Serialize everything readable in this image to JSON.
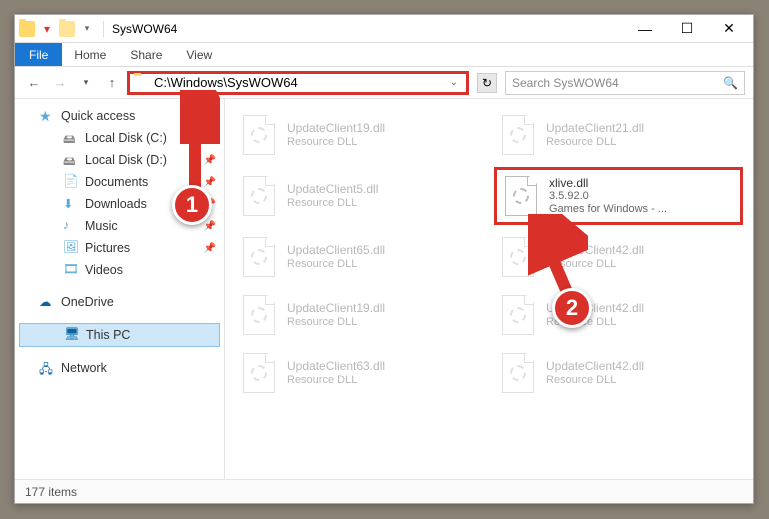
{
  "window": {
    "title": "SysWOW64"
  },
  "tabs": {
    "file": "File",
    "home": "Home",
    "share": "Share",
    "view": "View"
  },
  "nav": {
    "address": "C:\\Windows\\SysWOW64",
    "search_placeholder": "Search SysWOW64"
  },
  "sidebar": {
    "quick_access": "Quick access",
    "items": [
      {
        "label": "Local Disk (C:)"
      },
      {
        "label": "Local Disk (D:)"
      },
      {
        "label": "Documents"
      },
      {
        "label": "Downloads"
      },
      {
        "label": "Music"
      },
      {
        "label": "Pictures"
      },
      {
        "label": "Videos"
      }
    ],
    "onedrive": "OneDrive",
    "this_pc": "This PC",
    "network": "Network"
  },
  "files": {
    "row1a": {
      "name": "UpdateClient19.dll",
      "sub": "Resource DLL"
    },
    "row1b": {
      "name": "UpdateClient21.dll",
      "sub": "Resource DLL"
    },
    "row2a": {
      "name": "UpdateClient5.dll",
      "sub": "Resource DLL"
    },
    "row2b_hl": {
      "name": "xlive.dll",
      "ver": "3.5.92.0",
      "desc": "Games for Windows - ..."
    },
    "row3a": {
      "name": "UpdateClient65.dll",
      "sub": "Resource DLL"
    },
    "row3b": {
      "name": "UpdateClient42.dll",
      "sub": "Resource DLL"
    },
    "row4a": {
      "name": "UpdateClient19.dll",
      "sub": "Resource DLL"
    },
    "row4b": {
      "name": "UpdateClient42.dll",
      "sub": "Resource DLL"
    },
    "row5a": {
      "name": "UpdateClient63.dll",
      "sub": "Resource DLL"
    },
    "row5b": {
      "name": "UpdateClient42.dll",
      "sub": "Resource DLL"
    }
  },
  "status": {
    "text": "177 items"
  },
  "callouts": {
    "one": "1",
    "two": "2"
  }
}
